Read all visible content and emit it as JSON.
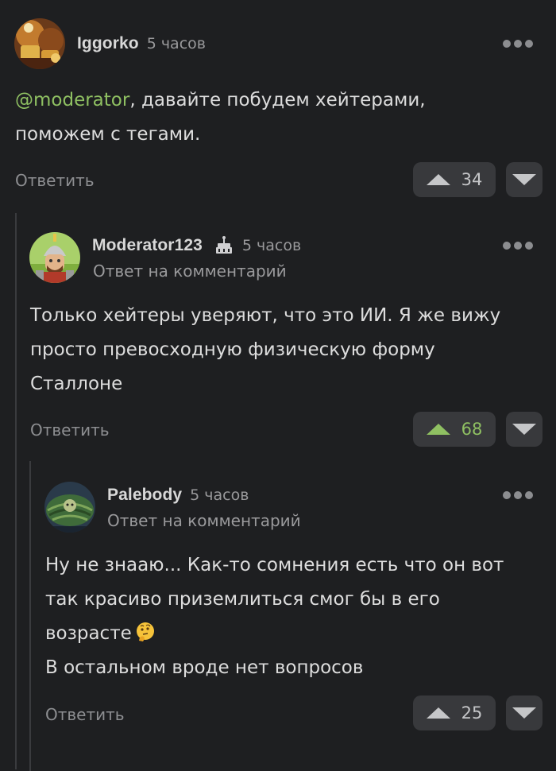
{
  "comments": [
    {
      "username": "Iggorko",
      "time": "5 часов",
      "mention": "@moderator",
      "text_line1": ", давайте побудем хейтерами,",
      "text_line2": "поможем с тегами.",
      "reply_label": "Ответить",
      "votes": "34",
      "vote_state": "neutral",
      "avatar_icon": "golden-pictures-avatar"
    },
    {
      "username": "Moderator123",
      "time": "5 часов",
      "badge_icon": "cake-icon",
      "reply_to": "Ответ на комментарий",
      "text_line1": "Только хейтеры уверяют, что это ИИ. Я же вижу",
      "text_line2": "просто превосходную физическую форму",
      "text_line3": "Сталлоне",
      "reply_label": "Ответить",
      "votes": "68",
      "vote_state": "positive",
      "avatar_icon": "knight-avatar"
    },
    {
      "username": "Palebody",
      "time": "5 часов",
      "reply_to": "Ответ на комментарий",
      "text_line1": "Ну не знааю... Как-то сомнения есть что он вот",
      "text_line2": "так красиво приземлиться смог бы в его",
      "text_line3": "возрасте",
      "text_line4": "В остальном вроде нет вопросов",
      "emoji": "thinking-face-emoji",
      "reply_label": "Ответить",
      "votes": "25",
      "vote_state": "neutral",
      "avatar_icon": "watermelon-avatar"
    }
  ],
  "colors": {
    "background": "#1e1f21",
    "accent_green": "#8fc062",
    "button_bg": "#38393c",
    "thread_line": "#3a3b3e"
  }
}
